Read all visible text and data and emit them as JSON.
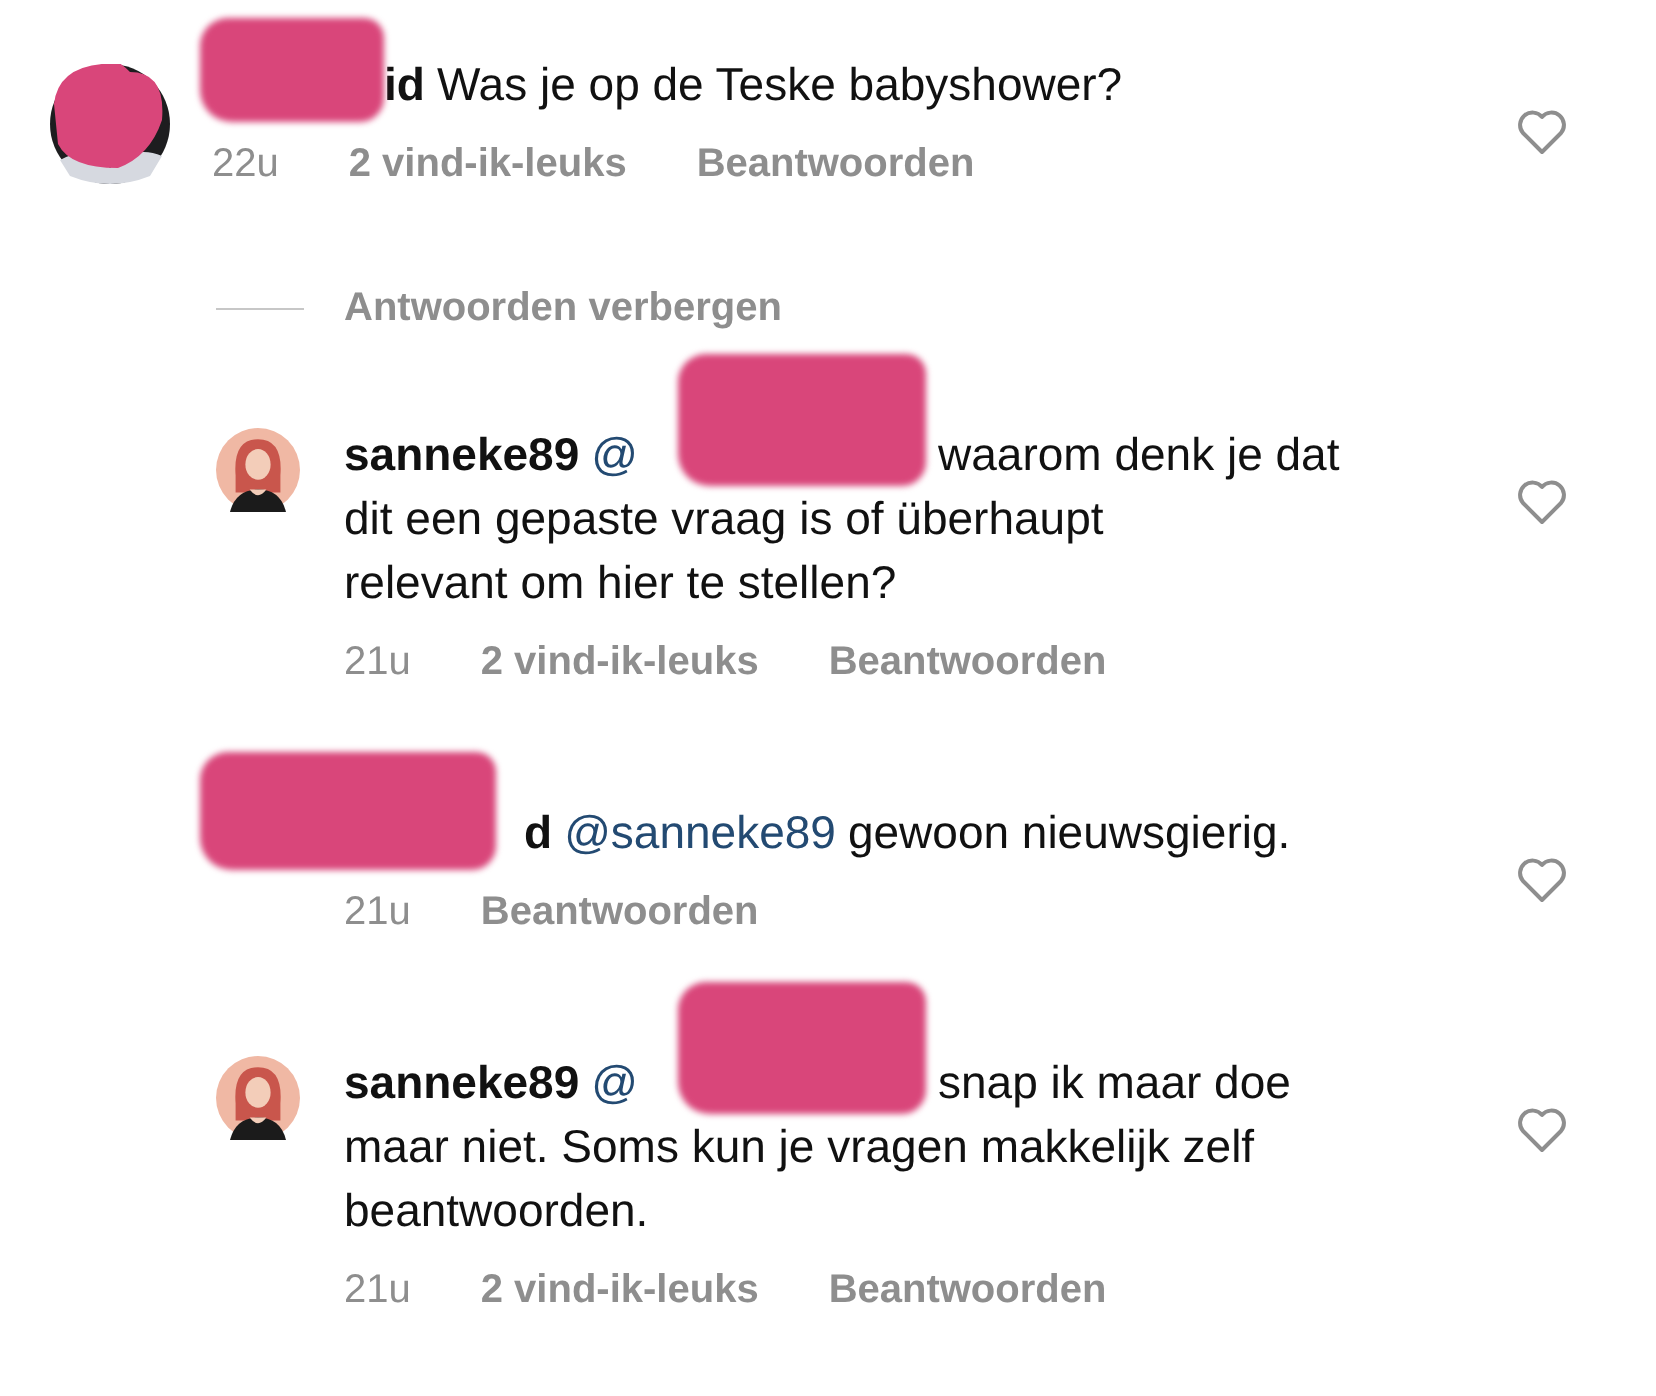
{
  "thread": [
    {
      "kind": "comment",
      "author_redacted": true,
      "username": "id",
      "text_lines": [
        "Was je op de Teske babyshower?"
      ],
      "time": "22u",
      "likes": "2 vind-ik-leuks",
      "reply": "Beantwoorden",
      "liked": false
    },
    {
      "kind": "hide-replies",
      "label": "Antwoorden verbergen"
    },
    {
      "kind": "reply",
      "mention_redacted": true,
      "username": "sanneke89",
      "mention": "@",
      "text_lines": [
        "waarom denk je dat",
        "dit een gepaste vraag is of überhaupt",
        "relevant om hier te stellen?"
      ],
      "time": "21u",
      "likes": "2 vind-ik-leuks",
      "reply": "Beantwoorden",
      "liked": false
    },
    {
      "kind": "reply",
      "author_redacted": true,
      "username": "d",
      "mention": "@sanneke89",
      "text_lines": [
        "gewoon nieuwsgierig."
      ],
      "time": "21u",
      "reply": "Beantwoorden",
      "liked": false
    },
    {
      "kind": "reply",
      "mention_redacted": true,
      "username": "sanneke89",
      "mention": "@",
      "text_lines": [
        "snap ik maar doe",
        "maar niet. Soms kun je vragen makkelijk zelf",
        "beantwoorden."
      ],
      "time": "21u",
      "likes": "2 vind-ik-leuks",
      "reply": "Beantwoorden",
      "liked": false
    }
  ]
}
